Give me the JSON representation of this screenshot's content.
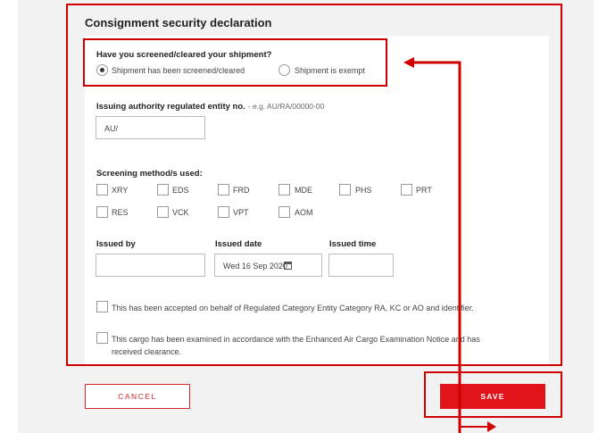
{
  "section_title": "Consignment security declaration",
  "screening_question": {
    "label": "Have you screened/cleared your shipment?",
    "options": [
      {
        "label": "Shipment has been screened/cleared",
        "selected": true
      },
      {
        "label": "Shipment is exempt",
        "selected": false
      }
    ]
  },
  "issuing_authority": {
    "label": "Issuing authority regulated entity no.",
    "hint": "- e.g. AU/RA/00000-00",
    "value": "AU/"
  },
  "screening_methods": {
    "label": "Screening method/s used:",
    "options": [
      "XRY",
      "EDS",
      "FRD",
      "MDE",
      "PHS",
      "PRT",
      "RES",
      "VCK",
      "VPT",
      "AOM"
    ]
  },
  "issued_by": {
    "label": "Issued by",
    "value": ""
  },
  "issued_date": {
    "label": "Issued date",
    "value": "Wed 16 Sep 2020"
  },
  "issued_time": {
    "label": "Issued time",
    "value": ""
  },
  "declarations": [
    "This has been accepted on behalf of Regulated Category Entity Category RA, KC or AO and identifier.",
    "This cargo has been examined in accordance with the Enhanced Air Cargo Examination Notice and has",
    "received clearance."
  ],
  "buttons": {
    "cancel": "CANCEL",
    "save": "SAVE"
  },
  "colors": {
    "brand_red": "#e1141b",
    "annotation_red": "#d00000"
  }
}
